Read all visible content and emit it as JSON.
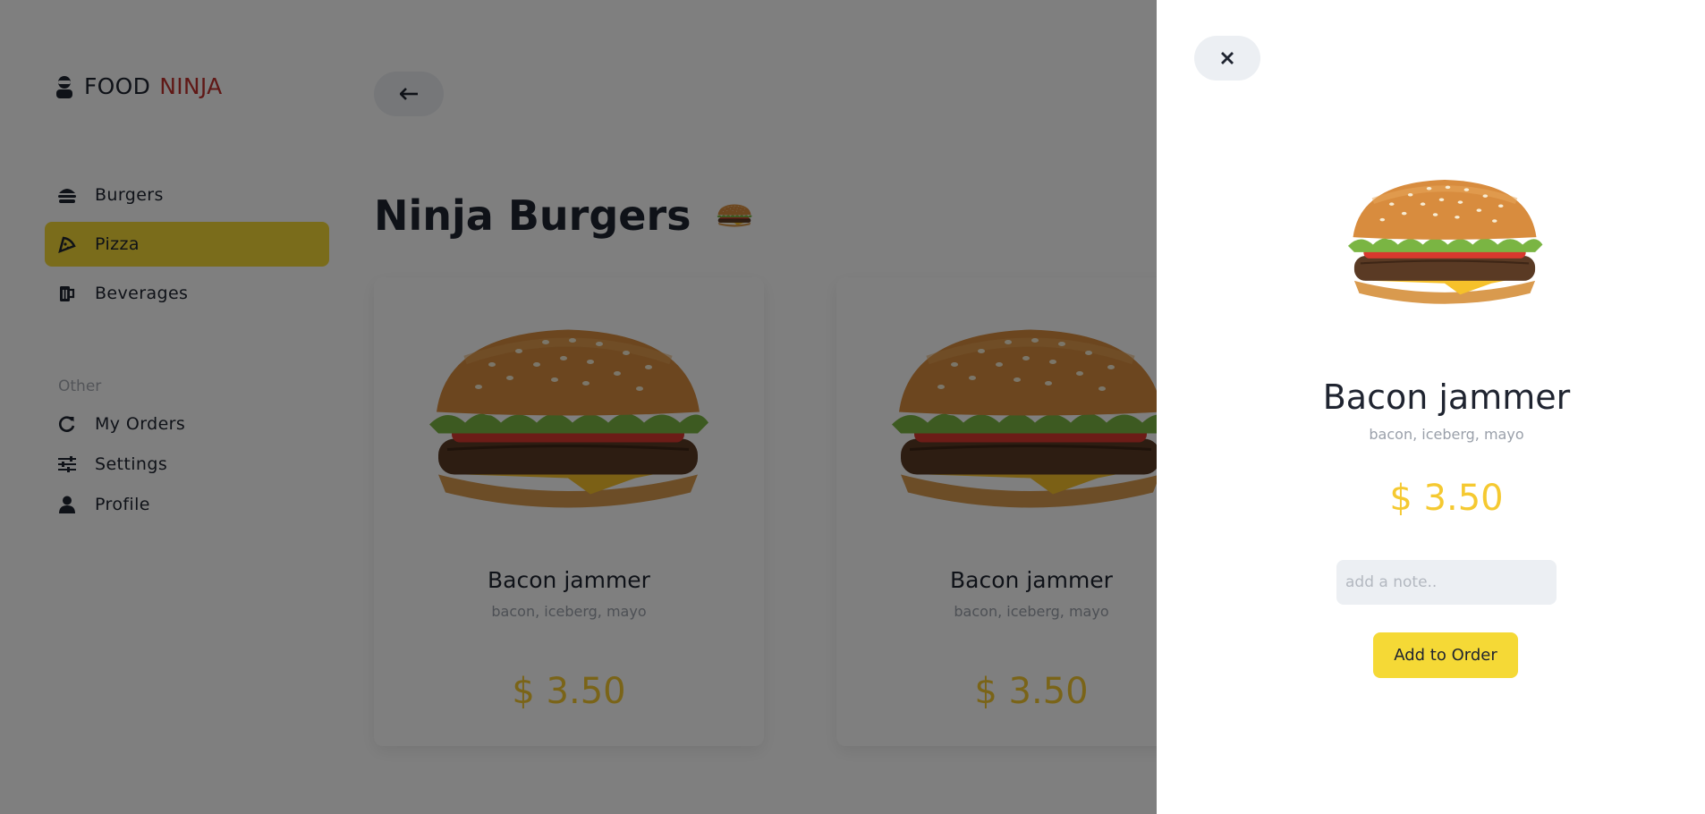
{
  "brand": {
    "text_plain": "FOOD",
    "text_accent": "NINJA",
    "accent_color": "#c0312d",
    "icon": "ninja-icon"
  },
  "sidebar": {
    "items": [
      {
        "label": "Burgers",
        "icon": "burger-icon",
        "active": false
      },
      {
        "label": "Pizza",
        "icon": "pizza-icon",
        "active": true
      },
      {
        "label": "Beverages",
        "icon": "beer-icon",
        "active": false
      }
    ],
    "section_label": "Other",
    "other_items": [
      {
        "label": "My Orders",
        "icon": "refresh-icon"
      },
      {
        "label": "Settings",
        "icon": "sliders-icon"
      },
      {
        "label": "Profile",
        "icon": "user-icon"
      }
    ]
  },
  "header": {
    "back_icon": "arrow-left-icon"
  },
  "main": {
    "title": "Ninja Burgers",
    "title_emoji": "hamburger-icon",
    "cards": [
      {
        "name": "Bacon jammer",
        "desc": "bacon, iceberg, mayo",
        "price": "$ 3.50"
      },
      {
        "name": "Bacon jammer",
        "desc": "bacon, iceberg, mayo",
        "price": "$ 3.50"
      }
    ]
  },
  "drawer": {
    "close_icon": "close-icon",
    "name": "Bacon jammer",
    "desc": "bacon, iceberg, mayo",
    "price": "$ 3.50",
    "note_placeholder": "add a note..",
    "add_label": "Add to Order"
  },
  "colors": {
    "accent_yellow": "#f5d936",
    "price_yellow": "#f5c931",
    "overlay": "rgba(0,0,0,0.5)"
  }
}
